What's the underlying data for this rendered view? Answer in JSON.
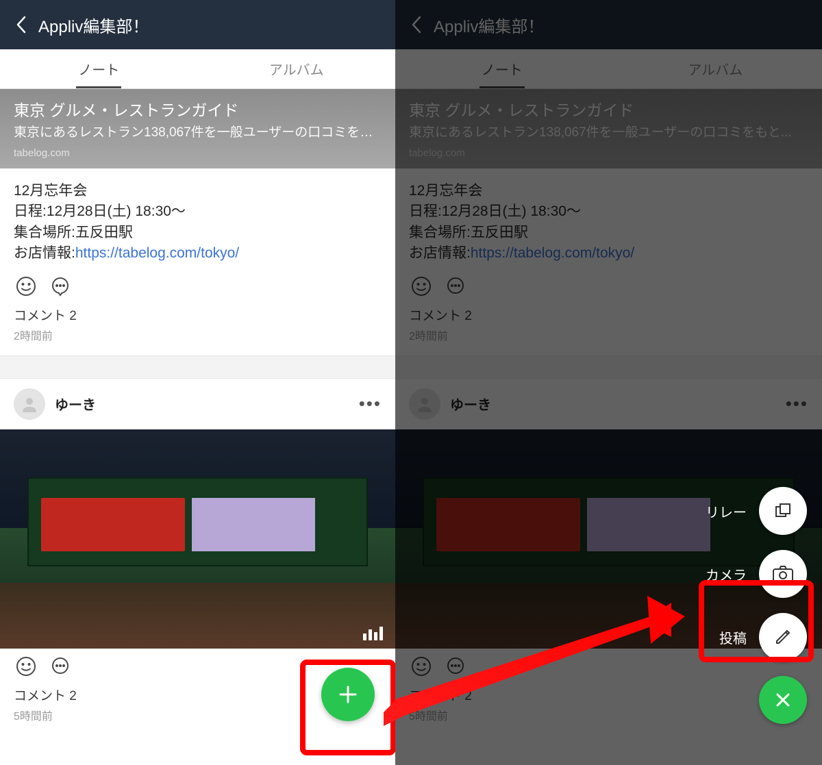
{
  "header": {
    "title": "Appliv編集部！"
  },
  "tabs": {
    "note": "ノート",
    "album": "アルバム"
  },
  "link_card": {
    "title": "東京 グルメ・レストランガイド",
    "desc": "東京にあるレストラン138,067件を一般ユーザーの口コミをもと...",
    "domain": "tabelog.com"
  },
  "post1": {
    "line1": "12月忘年会",
    "line2": "日程:12月28日(土) 18:30～",
    "line3": "集合場所:五反田駅",
    "line4_prefix": "お店情報:",
    "line4_link": "https://tabelog.com/tokyo/",
    "comments_label": "コメント 2",
    "time": "2時間前"
  },
  "post2": {
    "author": "ゆーき",
    "comments_label": "コメント 2",
    "time": "5時間前"
  },
  "menu": {
    "relay": "リレー",
    "camera": "カメラ",
    "post": "投稿"
  }
}
